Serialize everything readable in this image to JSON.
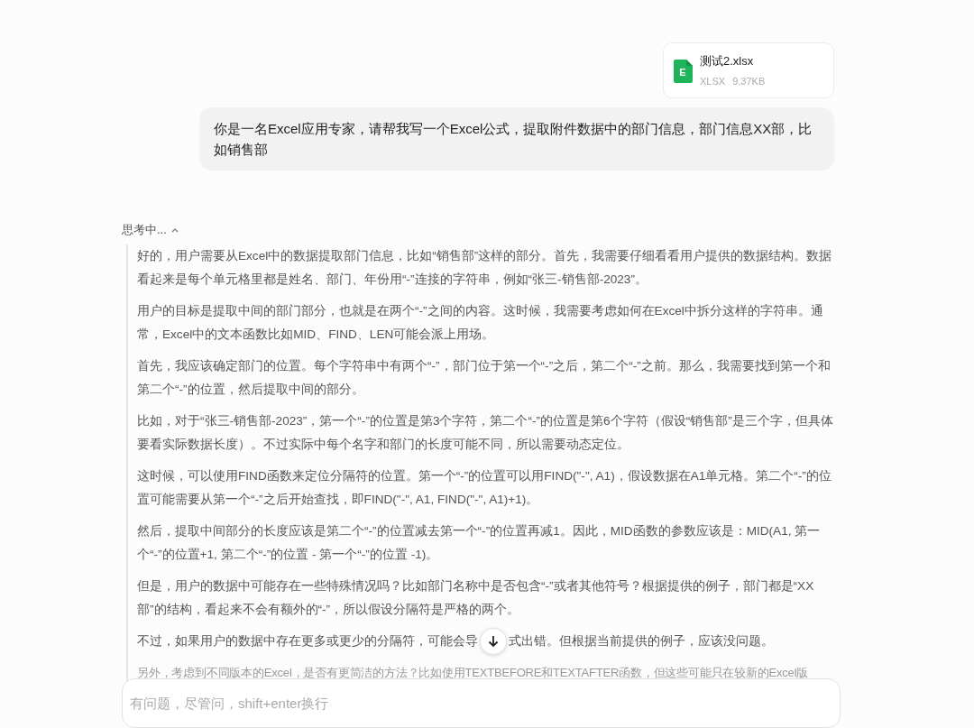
{
  "attachment": {
    "name": "测试2.xlsx",
    "type": "XLSX",
    "size": "9.37KB",
    "icon_letter": "E"
  },
  "user_message": "你是一名Excel应用专家，请帮我写一个Excel公式，提取附件数据中的部门信息，部门信息XX部，比如销售部",
  "thinking": {
    "label": "思考中...",
    "expanded": true,
    "paragraphs": [
      "好的，用户需要从Excel中的数据提取部门信息，比如“销售部”这样的部分。首先，我需要仔细看看用户提供的数据结构。数据看起来是每个单元格里都是姓名、部门、年份用“-”连接的字符串，例如“张三-销售部-2023”。",
      "用户的目标是提取中间的部门部分，也就是在两个“-”之间的内容。这时候，我需要考虑如何在Excel中拆分这样的字符串。通常，Excel中的文本函数比如MID、FIND、LEN可能会派上用场。",
      "首先，我应该确定部门的位置。每个字符串中有两个“-”，部门位于第一个“-”之后，第二个“-”之前。那么，我需要找到第一个和第二个“-”的位置，然后提取中间的部分。",
      "比如，对于“张三-销售部-2023”，第一个“-”的位置是第3个字符，第二个“-”的位置是第6个字符（假设“销售部”是三个字，但具体要看实际数据长度）。不过实际中每个名字和部门的长度可能不同，所以需要动态定位。",
      "这时候，可以使用FIND函数来定位分隔符的位置。第一个“-”的位置可以用FIND(\"-\", A1)，假设数据在A1单元格。第二个“-”的位置可能需要从第一个“-”之后开始查找，即FIND(\"-\", A1, FIND(\"-\", A1)+1)。",
      "然后，提取中间部分的长度应该是第二个“-”的位置减去第一个“-”的位置再减1。因此，MID函数的参数应该是：MID(A1, 第一个“-”的位置+1, 第二个“-”的位置 - 第一个“-”的位置 -1)。",
      "但是，用户的数据中可能存在一些特殊情况吗？比如部门名称中是否包含“-”或者其他符号？根据提供的例子，部门都是“XX部”的结构，看起来不会有额外的“-”，所以假设分隔符是严格的两个。",
      [
        "不过，如果用户的数据中存在更多或更少的分隔符，可能会导",
        "式出错。但根据当前提供的例子，应该没问题。"
      ],
      "另外，考虑到不同版本的Excel，是否有更简洁的方法？比如使用TEXTBEFORE和TEXTAFTER函数，但这些可能只在较新的Excel版"
    ]
  },
  "input": {
    "placeholder": "有问题，尽管问，shift+enter换行"
  }
}
